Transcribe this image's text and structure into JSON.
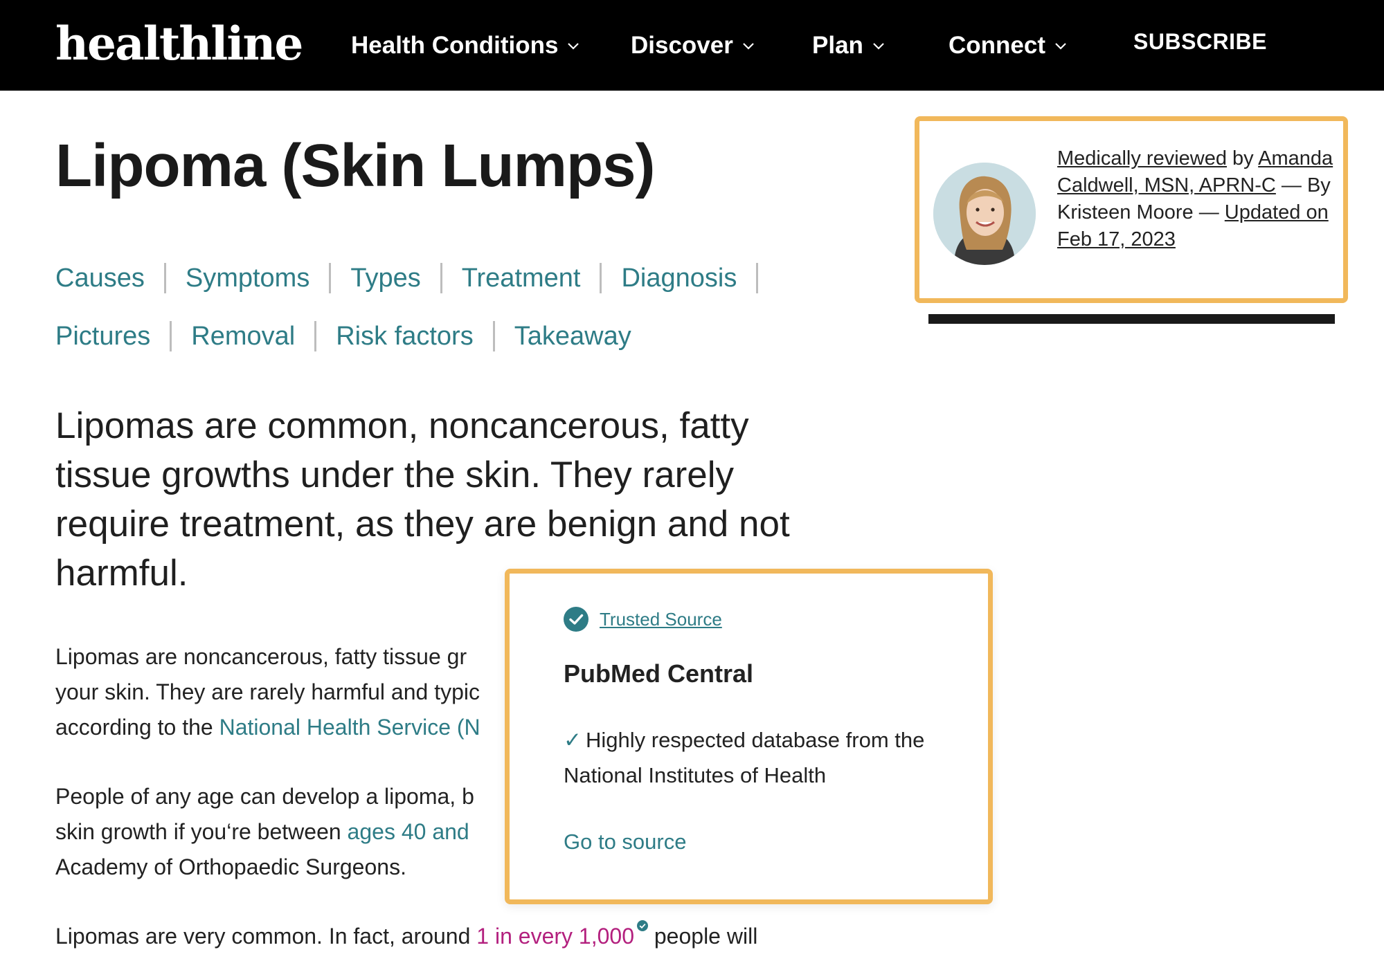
{
  "header": {
    "logo": "healthline",
    "nav": [
      {
        "label": "Health Conditions"
      },
      {
        "label": "Discover"
      },
      {
        "label": "Plan"
      },
      {
        "label": "Connect"
      }
    ],
    "subscribe": "SUBSCRIBE"
  },
  "article": {
    "title": "Lipoma (Skin Lumps)",
    "toc_row1": [
      "Causes",
      "Symptoms",
      "Types",
      "Treatment",
      "Diagnosis"
    ],
    "toc_row2": [
      "Pictures",
      "Removal",
      "Risk factors",
      "Takeaway"
    ],
    "lede": "Lipomas are common, noncancerous, fatty tissue growths under the skin. They rarely require treatment, as they are benign and not harmful.",
    "p1": {
      "line1": "Lipomas are noncancerous, fatty tissue gr",
      "line2": "your skin. They are rarely harmful and typic",
      "line3_pre": "according to the ",
      "line3_link": "National Health Service (N"
    },
    "p2": {
      "line1": "People of any age can develop a lipoma, b",
      "line2_pre": "skin growth if you‘re between ",
      "line2_link": "ages 40 and",
      "line3": "Academy of Orthopaedic Surgeons."
    },
    "p3": {
      "pre": "Lipomas are very common. In fact, around ",
      "link": "1 in every 1,000",
      "post": " people will"
    }
  },
  "reviewer": {
    "reviewed_label": "Medically reviewed",
    "by": " by",
    "reviewer_name": "Amanda Caldwell, MSN, APRN-C",
    "author_text": " — By Kristeen Moore — ",
    "updated": "Updated on Feb 17, 2023",
    "avatar_icon": "reviewer-avatar"
  },
  "popup": {
    "badge": "Trusted Source",
    "title": "PubMed Central",
    "check": "✓",
    "description": "Highly respected database from the National Institutes of Health",
    "go_link": "Go to source",
    "accent": "#2e7c86",
    "border": "#f1b85b"
  }
}
